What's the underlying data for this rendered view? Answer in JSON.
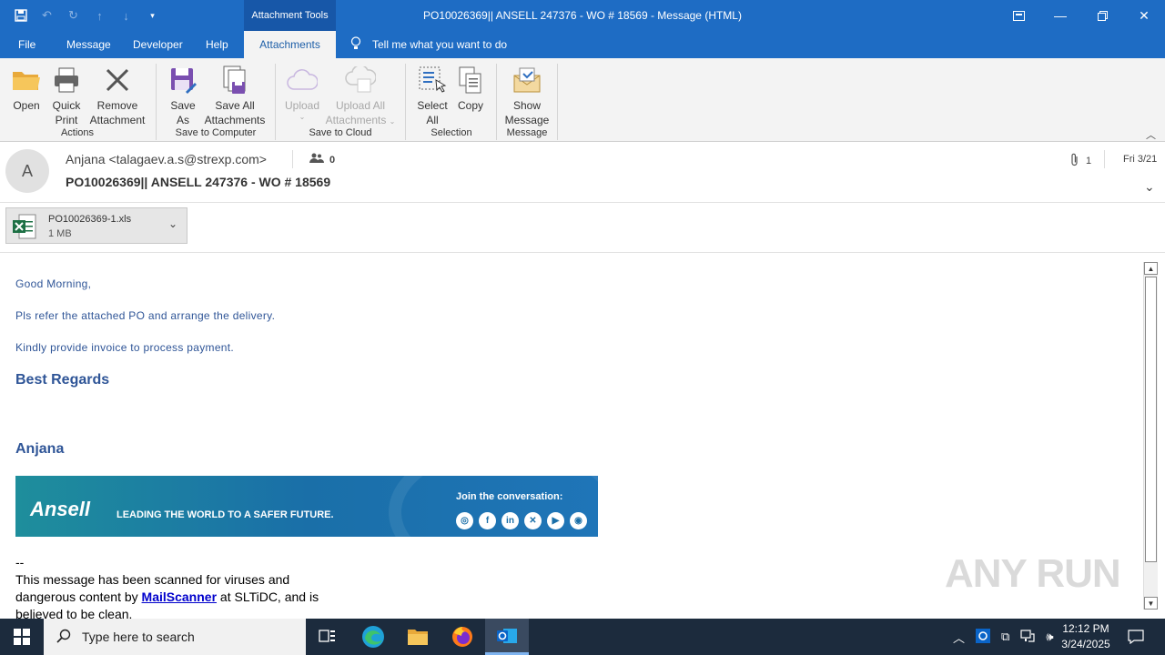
{
  "titlebar": {
    "context_tab": "Attachment Tools",
    "window_title": "PO10026369|| ANSELL 247376 - WO # 18569  -  Message (HTML)"
  },
  "menu": {
    "file": "File",
    "message": "Message",
    "developer": "Developer",
    "help": "Help",
    "attachments": "Attachments",
    "tell_me": "Tell me what you want to do"
  },
  "ribbon": {
    "open": "Open",
    "quick_print": [
      "Quick",
      "Print"
    ],
    "remove_attachment": [
      "Remove",
      "Attachment"
    ],
    "group_actions": "Actions",
    "save_as": [
      "Save",
      "As"
    ],
    "save_all": [
      "Save All",
      "Attachments"
    ],
    "group_save_computer": "Save to Computer",
    "upload": "Upload",
    "upload_all": [
      "Upload All",
      "Attachments"
    ],
    "group_save_cloud": "Save to Cloud",
    "select_all": [
      "Select",
      "All"
    ],
    "copy": "Copy",
    "group_selection": "Selection",
    "show_message": [
      "Show",
      "Message"
    ],
    "group_message": "Message"
  },
  "header": {
    "avatar_initial": "A",
    "sender": "Anjana <talagaev.a.s@strexp.com>",
    "people_count": "0",
    "subject": "PO10026369|| ANSELL 247376 - WO # 18569",
    "attachment_count": "1",
    "date": "Fri 3/21"
  },
  "attachment": {
    "name": "PO10026369-1.xls",
    "size": "1 MB"
  },
  "body": {
    "greeting": "Good Morning,",
    "line1": "Pls refer the attached PO and arrange  the delivery.",
    "line2": "Kindly provide invoice to process payment.",
    "regards": "Best Regards",
    "signature": "Anjana",
    "banner_logo": "Ansell",
    "banner_tagline": "LEADING THE WORLD TO A SAFER FUTURE.",
    "banner_join": "Join the conversation:",
    "dashes": "--",
    "scan_line1": "This message has been scanned for viruses and",
    "scan_pre": "dangerous content by ",
    "scan_link": "MailScanner",
    "scan_post": " at SLTiDC, and is",
    "scan_line3": "believed to be clean."
  },
  "watermark": "ANY RUN",
  "taskbar": {
    "search_placeholder": "Type here to search",
    "time": "12:12 PM",
    "date": "3/24/2025"
  }
}
